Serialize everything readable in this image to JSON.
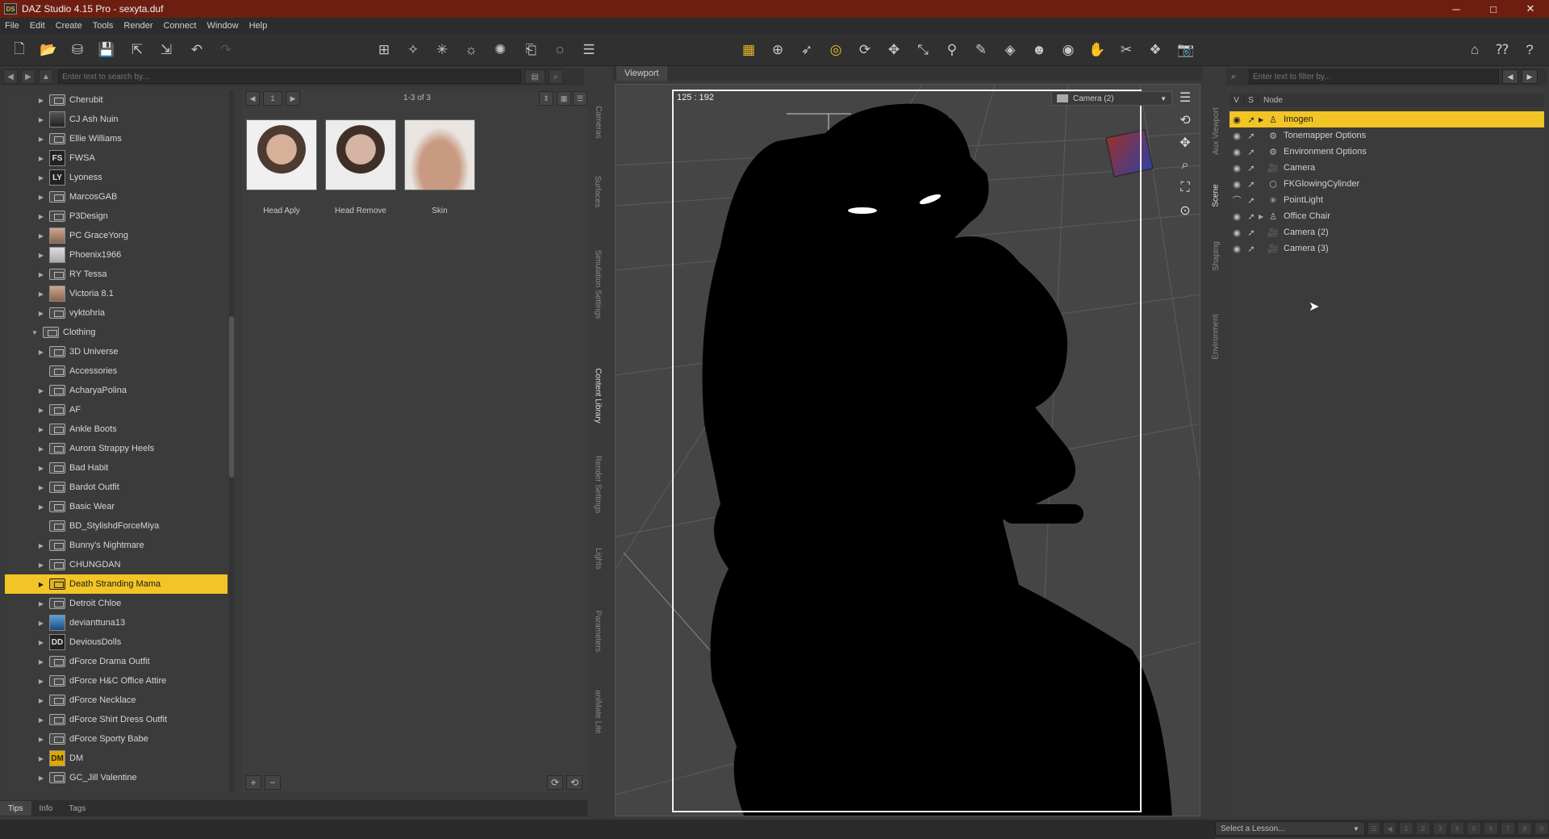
{
  "window": {
    "title": "DAZ Studio 4.15 Pro - sexyta.duf",
    "app_icon": "DS"
  },
  "window_controls": {
    "minimize": "─",
    "maximize": "□",
    "close": "✕"
  },
  "menu": [
    "File",
    "Edit",
    "Create",
    "Tools",
    "Render",
    "Connect",
    "Window",
    "Help"
  ],
  "content_library": {
    "search_placeholder": "Enter text to search by...",
    "tree": [
      {
        "label": "Cherubit",
        "icon": "folder"
      },
      {
        "label": "CJ Ash Nuin",
        "icon": "thumb-dark"
      },
      {
        "label": "Ellie Williams",
        "icon": "folder"
      },
      {
        "label": "FWSA",
        "icon": "thumb-text",
        "glyph": "FS"
      },
      {
        "label": "Lyoness",
        "icon": "thumb-text",
        "glyph": "LY"
      },
      {
        "label": "MarcosGAB",
        "icon": "folder"
      },
      {
        "label": "P3Design",
        "icon": "folder"
      },
      {
        "label": "PC GraceYong",
        "icon": "thumb-face"
      },
      {
        "label": "Phoenix1966",
        "icon": "thumb-light"
      },
      {
        "label": "RY Tessa",
        "icon": "folder"
      },
      {
        "label": "Victoria 8.1",
        "icon": "thumb-face"
      },
      {
        "label": "vyktohria",
        "icon": "folder"
      },
      {
        "label": "Clothing",
        "icon": "folder",
        "expanded": true,
        "level": 0
      },
      {
        "label": "3D Universe",
        "icon": "folder"
      },
      {
        "label": "Accessories",
        "icon": "folder",
        "no_arrow": true
      },
      {
        "label": "AcharyaPolina",
        "icon": "folder"
      },
      {
        "label": "AF",
        "icon": "folder"
      },
      {
        "label": "Ankle Boots",
        "icon": "folder"
      },
      {
        "label": "Aurora Strappy Heels",
        "icon": "folder"
      },
      {
        "label": "Bad Habit",
        "icon": "folder"
      },
      {
        "label": "Bardot Outfit",
        "icon": "folder"
      },
      {
        "label": "Basic Wear",
        "icon": "folder"
      },
      {
        "label": "BD_StylishdForceMiya",
        "icon": "folder",
        "no_arrow": true
      },
      {
        "label": "Bunny's Nightmare",
        "icon": "folder"
      },
      {
        "label": "CHUNGDAN",
        "icon": "folder"
      },
      {
        "label": "Death Stranding Mama",
        "icon": "folder",
        "selected": true
      },
      {
        "label": "Detroit Chloe",
        "icon": "folder"
      },
      {
        "label": "devianttuna13",
        "icon": "thumb-blue"
      },
      {
        "label": "DeviousDolls",
        "icon": "thumb-text",
        "glyph": "DD"
      },
      {
        "label": "dForce Drama Outfit",
        "icon": "folder"
      },
      {
        "label": "dForce H&C Office Attire",
        "icon": "folder"
      },
      {
        "label": "dForce Necklace",
        "icon": "folder"
      },
      {
        "label": "dForce Shirt Dress Outfit",
        "icon": "folder"
      },
      {
        "label": "dForce Sporty Babe",
        "icon": "folder"
      },
      {
        "label": "DM",
        "icon": "thumb-dm",
        "glyph": "DM"
      },
      {
        "label": "GC_Jill Valentine",
        "icon": "folder"
      }
    ],
    "page_number": "1",
    "page_count": "1-3 of 3",
    "assets": [
      {
        "label": "Head Aply",
        "thumb": "face1"
      },
      {
        "label": "Head Remove",
        "thumb": "face2"
      },
      {
        "label": "Skin",
        "thumb": "skin"
      }
    ],
    "add_label": "+",
    "remove_label": "−",
    "bottom_tabs": [
      "Tips",
      "Info",
      "Tags"
    ]
  },
  "left_vertical_tabs": [
    "Cameras",
    "Surfaces",
    "Simulation Settings",
    "Content Library",
    "Render Settings",
    "Lights",
    "Parameters",
    "aniMate Lite"
  ],
  "viewport": {
    "tab_label": "Viewport",
    "coords": "125 : 192",
    "camera": "Camera (2)"
  },
  "right_vertical_tabs": [
    "Aux Viewport",
    "Scene",
    "Shaping",
    "Environment"
  ],
  "scene": {
    "filter_placeholder": "Enter text to filter by...",
    "header": {
      "v": "V",
      "s": "S",
      "node": "Node"
    },
    "nodes": [
      {
        "label": "Imogen",
        "icon": "figure",
        "expandable": true,
        "selected": true
      },
      {
        "label": "Tonemapper Options",
        "icon": "options"
      },
      {
        "label": "Environment Options",
        "icon": "options"
      },
      {
        "label": "Camera",
        "icon": "camera"
      },
      {
        "label": "FKGlowingCylinder",
        "icon": "cylinder"
      },
      {
        "label": "PointLight",
        "icon": "light"
      },
      {
        "label": "Office Chair",
        "icon": "figure",
        "expandable": true
      },
      {
        "label": "Camera (2)",
        "icon": "camera"
      },
      {
        "label": "Camera (3)",
        "icon": "camera"
      }
    ]
  },
  "lessons": {
    "placeholder": "Select a Lesson...",
    "steps": [
      "1",
      "2",
      "3",
      "4",
      "5",
      "6",
      "7",
      "8",
      "9"
    ]
  },
  "colors": {
    "accent": "#f2c425",
    "titlebar": "#6e1e10",
    "panel": "#3b3b3b"
  }
}
